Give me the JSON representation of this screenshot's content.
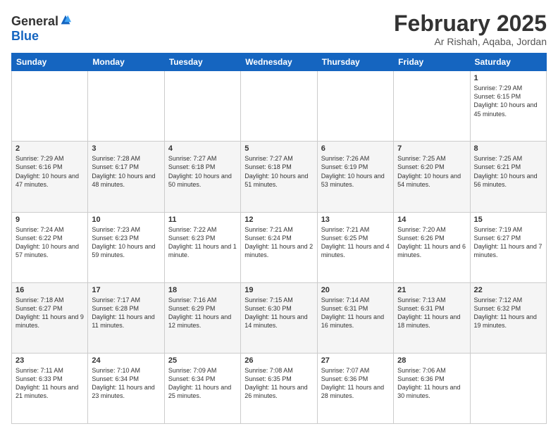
{
  "logo": {
    "general": "General",
    "blue": "Blue"
  },
  "header": {
    "title": "February 2025",
    "location": "Ar Rishah, Aqaba, Jordan"
  },
  "days": [
    "Sunday",
    "Monday",
    "Tuesday",
    "Wednesday",
    "Thursday",
    "Friday",
    "Saturday"
  ],
  "weeks": [
    [
      {
        "day": "",
        "info": ""
      },
      {
        "day": "",
        "info": ""
      },
      {
        "day": "",
        "info": ""
      },
      {
        "day": "",
        "info": ""
      },
      {
        "day": "",
        "info": ""
      },
      {
        "day": "",
        "info": ""
      },
      {
        "day": "1",
        "info": "Sunrise: 7:29 AM\nSunset: 6:15 PM\nDaylight: 10 hours\nand 45 minutes."
      }
    ],
    [
      {
        "day": "2",
        "info": "Sunrise: 7:29 AM\nSunset: 6:16 PM\nDaylight: 10 hours\nand 47 minutes."
      },
      {
        "day": "3",
        "info": "Sunrise: 7:28 AM\nSunset: 6:17 PM\nDaylight: 10 hours\nand 48 minutes."
      },
      {
        "day": "4",
        "info": "Sunrise: 7:27 AM\nSunset: 6:18 PM\nDaylight: 10 hours\nand 50 minutes."
      },
      {
        "day": "5",
        "info": "Sunrise: 7:27 AM\nSunset: 6:18 PM\nDaylight: 10 hours\nand 51 minutes."
      },
      {
        "day": "6",
        "info": "Sunrise: 7:26 AM\nSunset: 6:19 PM\nDaylight: 10 hours\nand 53 minutes."
      },
      {
        "day": "7",
        "info": "Sunrise: 7:25 AM\nSunset: 6:20 PM\nDaylight: 10 hours\nand 54 minutes."
      },
      {
        "day": "8",
        "info": "Sunrise: 7:25 AM\nSunset: 6:21 PM\nDaylight: 10 hours\nand 56 minutes."
      }
    ],
    [
      {
        "day": "9",
        "info": "Sunrise: 7:24 AM\nSunset: 6:22 PM\nDaylight: 10 hours\nand 57 minutes."
      },
      {
        "day": "10",
        "info": "Sunrise: 7:23 AM\nSunset: 6:23 PM\nDaylight: 10 hours\nand 59 minutes."
      },
      {
        "day": "11",
        "info": "Sunrise: 7:22 AM\nSunset: 6:23 PM\nDaylight: 11 hours\nand 1 minute."
      },
      {
        "day": "12",
        "info": "Sunrise: 7:21 AM\nSunset: 6:24 PM\nDaylight: 11 hours\nand 2 minutes."
      },
      {
        "day": "13",
        "info": "Sunrise: 7:21 AM\nSunset: 6:25 PM\nDaylight: 11 hours\nand 4 minutes."
      },
      {
        "day": "14",
        "info": "Sunrise: 7:20 AM\nSunset: 6:26 PM\nDaylight: 11 hours\nand 6 minutes."
      },
      {
        "day": "15",
        "info": "Sunrise: 7:19 AM\nSunset: 6:27 PM\nDaylight: 11 hours\nand 7 minutes."
      }
    ],
    [
      {
        "day": "16",
        "info": "Sunrise: 7:18 AM\nSunset: 6:27 PM\nDaylight: 11 hours\nand 9 minutes."
      },
      {
        "day": "17",
        "info": "Sunrise: 7:17 AM\nSunset: 6:28 PM\nDaylight: 11 hours\nand 11 minutes."
      },
      {
        "day": "18",
        "info": "Sunrise: 7:16 AM\nSunset: 6:29 PM\nDaylight: 11 hours\nand 12 minutes."
      },
      {
        "day": "19",
        "info": "Sunrise: 7:15 AM\nSunset: 6:30 PM\nDaylight: 11 hours\nand 14 minutes."
      },
      {
        "day": "20",
        "info": "Sunrise: 7:14 AM\nSunset: 6:31 PM\nDaylight: 11 hours\nand 16 minutes."
      },
      {
        "day": "21",
        "info": "Sunrise: 7:13 AM\nSunset: 6:31 PM\nDaylight: 11 hours\nand 18 minutes."
      },
      {
        "day": "22",
        "info": "Sunrise: 7:12 AM\nSunset: 6:32 PM\nDaylight: 11 hours\nand 19 minutes."
      }
    ],
    [
      {
        "day": "23",
        "info": "Sunrise: 7:11 AM\nSunset: 6:33 PM\nDaylight: 11 hours\nand 21 minutes."
      },
      {
        "day": "24",
        "info": "Sunrise: 7:10 AM\nSunset: 6:34 PM\nDaylight: 11 hours\nand 23 minutes."
      },
      {
        "day": "25",
        "info": "Sunrise: 7:09 AM\nSunset: 6:34 PM\nDaylight: 11 hours\nand 25 minutes."
      },
      {
        "day": "26",
        "info": "Sunrise: 7:08 AM\nSunset: 6:35 PM\nDaylight: 11 hours\nand 26 minutes."
      },
      {
        "day": "27",
        "info": "Sunrise: 7:07 AM\nSunset: 6:36 PM\nDaylight: 11 hours\nand 28 minutes."
      },
      {
        "day": "28",
        "info": "Sunrise: 7:06 AM\nSunset: 6:36 PM\nDaylight: 11 hours\nand 30 minutes."
      },
      {
        "day": "",
        "info": ""
      }
    ]
  ]
}
